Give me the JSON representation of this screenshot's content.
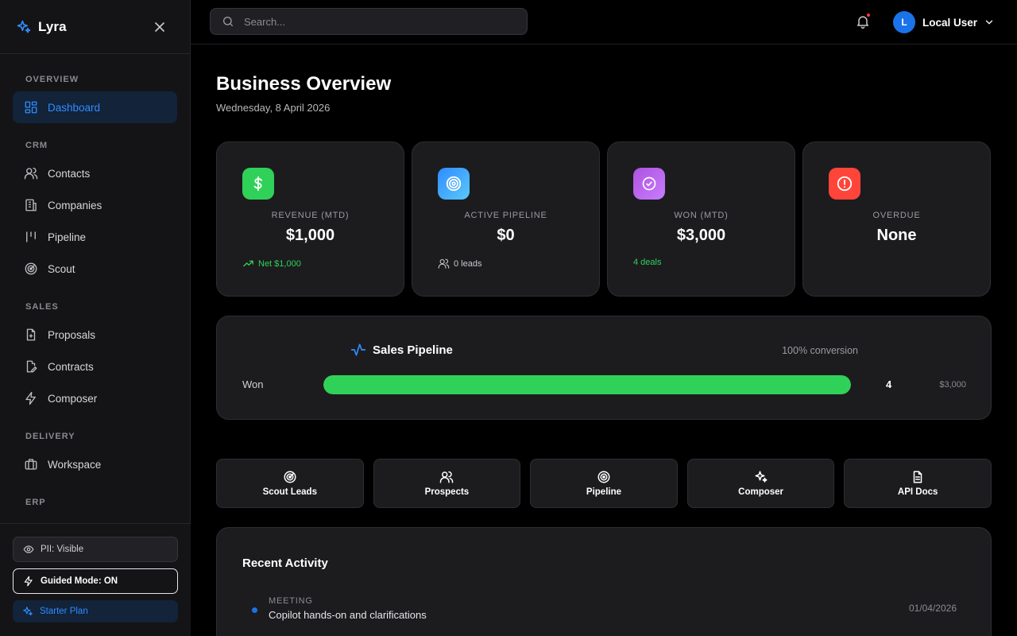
{
  "brand": {
    "name": "Lyra"
  },
  "sidebar": {
    "sections": {
      "overview": "OVERVIEW",
      "crm": "CRM",
      "sales": "SALES",
      "delivery": "DELIVERY",
      "erp": "ERP"
    },
    "items": {
      "dashboard": "Dashboard",
      "contacts": "Contacts",
      "companies": "Companies",
      "pipeline": "Pipeline",
      "scout": "Scout",
      "proposals": "Proposals",
      "contracts": "Contracts",
      "composer": "Composer",
      "workspace": "Workspace"
    },
    "bottom": {
      "pii": "PII: Visible",
      "guided": "Guided Mode: ON",
      "plan": "Starter Plan"
    }
  },
  "topbar": {
    "search_placeholder": "Search...",
    "user_initial": "L",
    "user_name": "Local User"
  },
  "page": {
    "title": "Business Overview",
    "date": "Wednesday, 8 April 2026"
  },
  "stats": {
    "revenue": {
      "label": "REVENUE (MTD)",
      "value": "$1,000",
      "foot": "Net $1,000"
    },
    "pipeline": {
      "label": "ACTIVE PIPELINE",
      "value": "$0",
      "foot": "0 leads"
    },
    "won": {
      "label": "WON (MTD)",
      "value": "$3,000",
      "foot": "4 deals"
    },
    "overdue": {
      "label": "OVERDUE",
      "value": "None"
    }
  },
  "sales_pipeline": {
    "title": "Sales Pipeline",
    "conversion": "100% conversion",
    "stage": "Won",
    "fill_percent": 100,
    "count": "4",
    "amount": "$3,000"
  },
  "quick_actions": {
    "scout_leads": "Scout Leads",
    "prospects": "Prospects",
    "pipeline": "Pipeline",
    "composer": "Composer",
    "api_docs": "API Docs"
  },
  "activity": {
    "title": "Recent Activity",
    "items": [
      {
        "type": "MEETING",
        "description": "Copilot hands-on and clarifications",
        "date": "01/04/2026"
      }
    ]
  },
  "colors": {
    "accent": "#2f8cff",
    "green": "#30d158",
    "purple": "#af52de",
    "red": "#ff453a"
  }
}
